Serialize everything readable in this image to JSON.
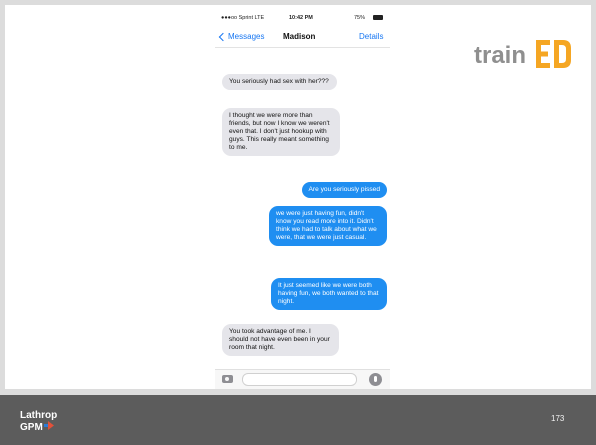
{
  "status_bar": {
    "carrier": "●●●oo Sprint LTE",
    "time": "10:42 PM",
    "battery": "75%"
  },
  "nav": {
    "back_label": "Messages",
    "contact_name": "Madison",
    "details_label": "Details"
  },
  "messages": [
    {
      "direction": "received",
      "text": "You seriously had sex with her???"
    },
    {
      "direction": "received",
      "text": "I thought we were more than friends, but now I know we weren't even that. I don't just hookup with guys. This really meant something to me."
    },
    {
      "direction": "sent",
      "text": "Are you seriously pissed"
    },
    {
      "direction": "sent",
      "text": "we were just having fun, didn't know you read more into it. Didn't think we had to talk about what we were, that we were just casual."
    },
    {
      "direction": "sent",
      "text": "It just seemed like we were both having fun, we both wanted to that night."
    },
    {
      "direction": "received",
      "text": "You took advantage of me. I should not have even been in your room that night."
    }
  ],
  "logos": {
    "trained": {
      "text": "train",
      "icon": "E-D-letters"
    },
    "footer": {
      "line1": "Lathrop",
      "line2": "GPM"
    }
  },
  "page_number": "173",
  "colors": {
    "sent_bubble": "#1f8ef1",
    "received_bubble": "#e5e5ea",
    "ios_blue": "#1877f2",
    "logo_gray": "#8f8f8f",
    "logo_orange": "#f5a623",
    "footer_bg": "#5c5c5c"
  }
}
